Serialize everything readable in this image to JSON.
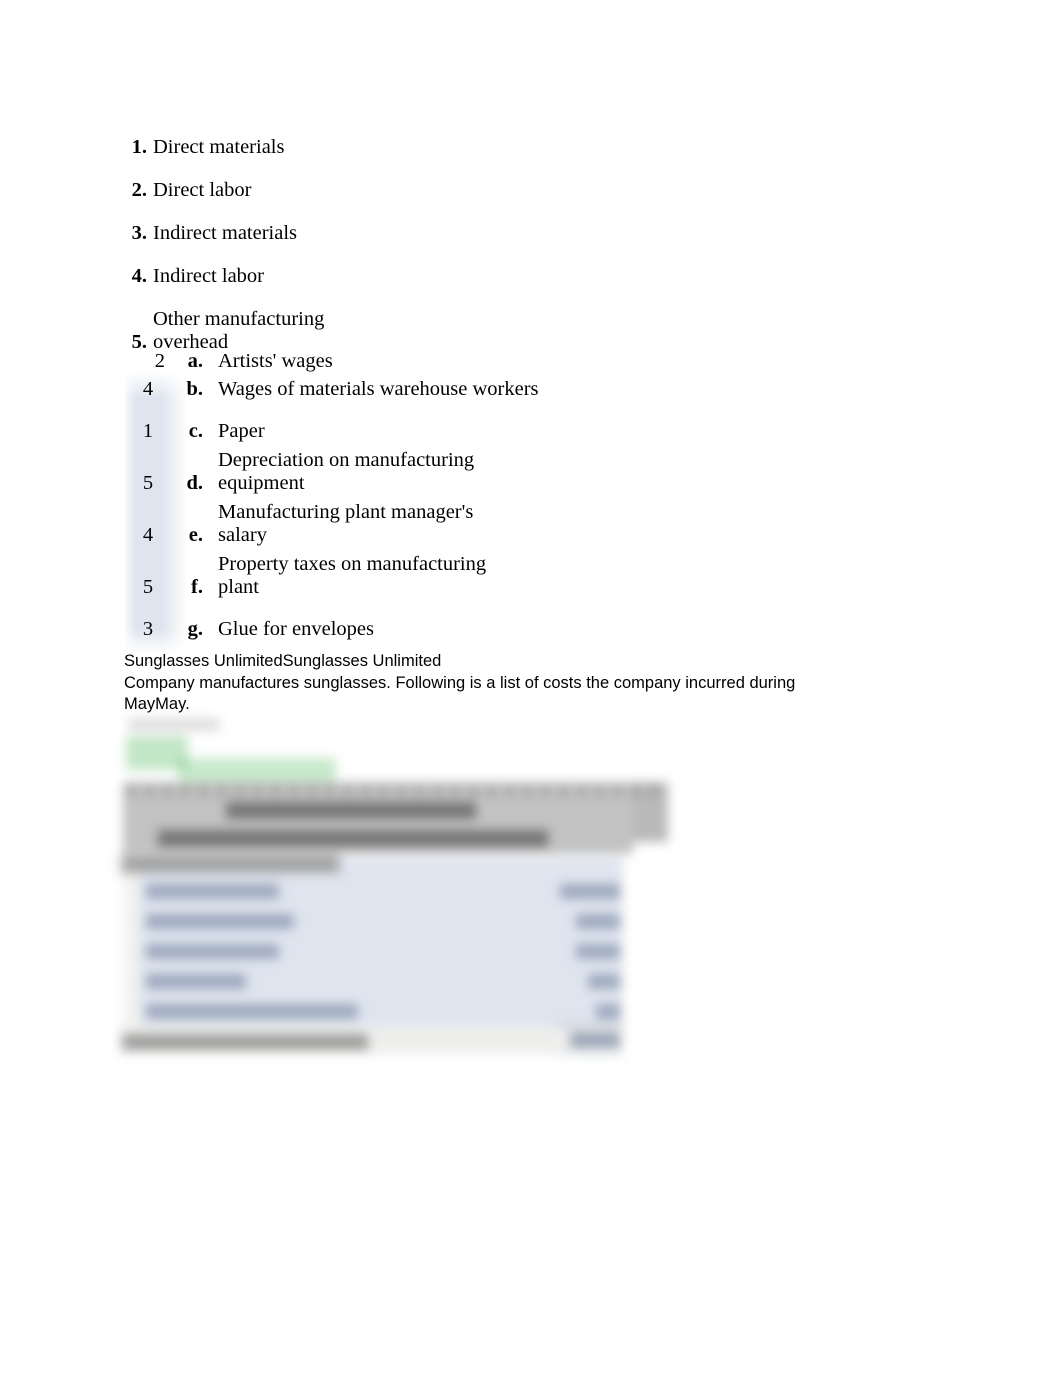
{
  "document": {
    "cost_categories": [
      {
        "number": "1.",
        "label": "Direct materials",
        "wraps": false
      },
      {
        "number": "2.",
        "label": "Direct labor",
        "wraps": false
      },
      {
        "number": "3.",
        "label": "Indirect materials",
        "wraps": false
      },
      {
        "number": "4.",
        "label": "Indirect labor",
        "wraps": false
      },
      {
        "number": "5.",
        "label_line1": "Other manufacturing",
        "label_line2": "overhead",
        "wraps": true
      }
    ],
    "cost_items": [
      {
        "answer": "2",
        "letter": "a.",
        "description": "Artists' wages",
        "wraps": false
      },
      {
        "answer": "4",
        "letter": "b.",
        "description": "Wages of materials warehouse workers",
        "wraps": false
      },
      {
        "answer": "1",
        "letter": "c.",
        "description": "Paper",
        "wraps": false
      },
      {
        "answer": "5",
        "letter": "d.",
        "description_line1": "Depreciation on manufacturing",
        "description_line2": "equipment",
        "wraps": true
      },
      {
        "answer": "4",
        "letter": "e.",
        "description_line1": "Manufacturing plant manager's",
        "description_line2": "salary",
        "wraps": true
      },
      {
        "answer": "5",
        "letter": "f.",
        "description_line1": "Property taxes on manufacturing",
        "description_line2": "plant",
        "wraps": true
      },
      {
        "answer": "3",
        "letter": "g.",
        "description": "Glue for envelopes",
        "wraps": false
      }
    ],
    "paragraph": {
      "line1": "Sunglasses UnlimitedSunglasses Unlimited",
      "line2": "Company manufactures sunglasses. Following is a list of costs the company incurred during",
      "line3": "MayMay."
    },
    "attached_table": {
      "legible": false,
      "note": "Blurred pasted spreadsheet image — text not legible",
      "row_count": 5
    },
    "colors": {
      "highlight": "#dfe5ee",
      "table_body": "#dfe5ef",
      "table_header": "#b9b9b9",
      "total_band": "#eeeeec",
      "accent_green": "#70c47a"
    }
  }
}
